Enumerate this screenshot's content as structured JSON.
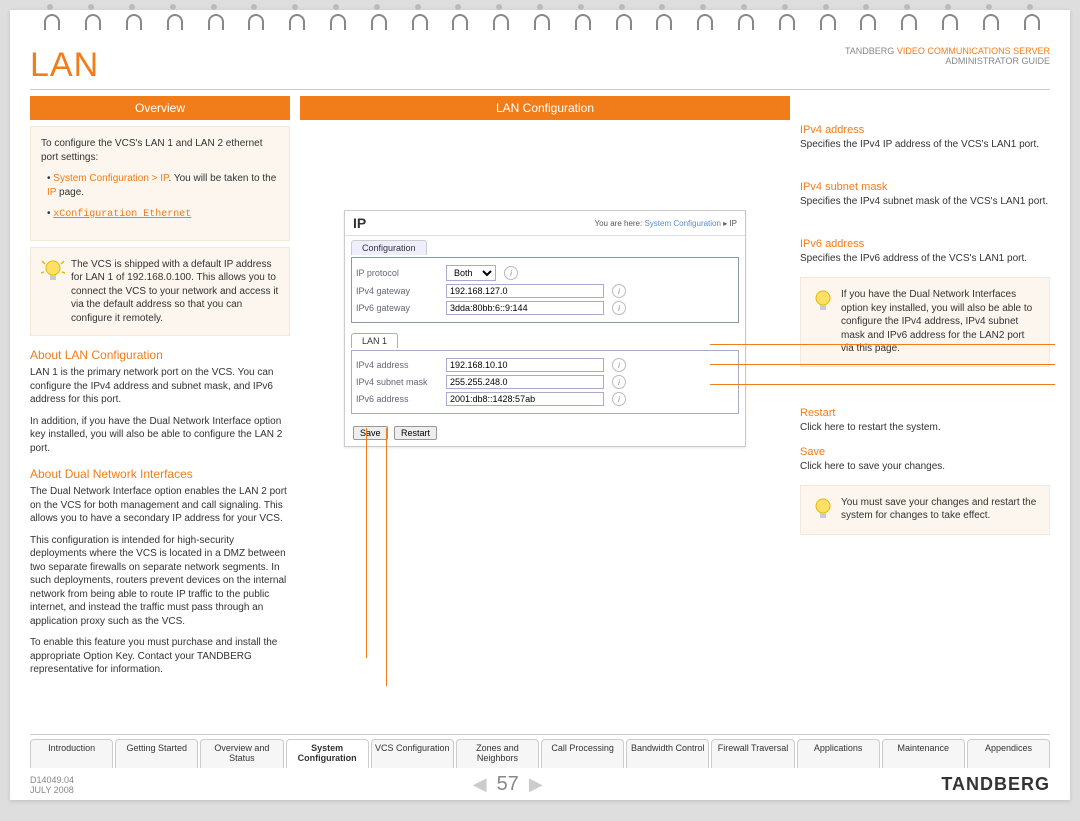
{
  "header": {
    "title": "LAN",
    "brand_prefix": "TANDBERG",
    "brand_suffix": "VIDEO COMMUNICATIONS SERVER",
    "subtitle": "ADMINISTRATOR GUIDE"
  },
  "left": {
    "section_title": "Overview",
    "intro": "To configure the VCS's LAN 1 and LAN 2 ethernet port settings:",
    "bullet1a": "System Configuration > IP",
    "bullet1b": ". You will be taken to the ",
    "bullet1c": "IP",
    "bullet1d": " page.",
    "bullet2": "xConfiguration Ethernet",
    "tip1": "The VCS is shipped with a default IP address for LAN 1 of 192.168.0.100. This allows you to connect the VCS to your network and access it via the default address so that you can configure it remotely.",
    "sub1": "About LAN Configuration",
    "p1": "LAN 1 is the primary network port on the VCS. You can configure the IPv4 address and subnet mask, and IPv6 address for this port.",
    "p2": "In addition, if you have the Dual Network Interface option key installed, you will also be able to configure the LAN 2 port.",
    "sub2": "About Dual Network Interfaces",
    "p3": "The Dual Network Interface option enables the LAN 2 port on the VCS for both management and call signaling.  This allows you to have a secondary IP address for your VCS.",
    "p4": "This configuration is intended for high-security deployments where the VCS is located in a DMZ between two separate firewalls on separate network segments.  In such deployments, routers prevent devices on the internal network from being able to route IP traffic to the public internet, and instead the traffic must pass through an application proxy such as the VCS.",
    "p5": "To enable this feature you must purchase and install the appropriate Option Key.  Contact your TANDBERG representative for information."
  },
  "center": {
    "section_title": "LAN Configuration",
    "shot": {
      "title": "IP",
      "bc_prefix": "You are here:",
      "bc_link": "System Configuration",
      "bc_sep": "▸",
      "bc_curr": "IP",
      "tab_config": "Configuration",
      "rows": {
        "ip_protocol_label": "IP protocol",
        "ip_protocol_value": "Both",
        "ipv4_gateway_label": "IPv4 gateway",
        "ipv4_gateway_value": "192.168.127.0",
        "ipv6_gateway_label": "IPv6 gateway",
        "ipv6_gateway_value": "3dda:80bb:6::9:144"
      },
      "lan1_title": "LAN 1",
      "lan1": {
        "ipv4_addr_label": "IPv4 address",
        "ipv4_addr_value": "192.168.10.10",
        "ipv4_mask_label": "IPv4 subnet mask",
        "ipv4_mask_value": "255.255.248.0",
        "ipv6_addr_label": "IPv6 address",
        "ipv6_addr_value": "2001:db8::1428:57ab"
      },
      "save": "Save",
      "restart": "Restart"
    }
  },
  "right": {
    "d1h": "IPv4 address",
    "d1": "Specifies the IPv4 IP address of the VCS's LAN1 port.",
    "d2h": "IPv4 subnet mask",
    "d2": "Specifies the IPv4 subnet mask of the VCS's LAN1 port.",
    "d3h": "IPv6 address",
    "d3": "Specifies the IPv6 address of the VCS's LAN1 port.",
    "tip": "If you have the Dual Network Interfaces option key installed, you will also be able to configure the IPv4 address, IPv4 subnet mask and IPv6 address for the LAN2 port via this page.",
    "d4h": "Restart",
    "d4": "Click here to restart the system.",
    "d5h": "Save",
    "d5": "Click here to save your changes.",
    "tip2": "You must save your changes and restart the system for changes to take effect."
  },
  "footer": {
    "tabs": [
      "Introduction",
      "Getting Started",
      "Overview and Status",
      "System Configuration",
      "VCS Configuration",
      "Zones and Neighbors",
      "Call Processing",
      "Bandwidth Control",
      "Firewall Traversal",
      "Applications",
      "Maintenance",
      "Appendices"
    ],
    "doc_id": "D14049.04",
    "doc_date": "JULY 2008",
    "page": "57",
    "brand": "TANDBERG"
  }
}
